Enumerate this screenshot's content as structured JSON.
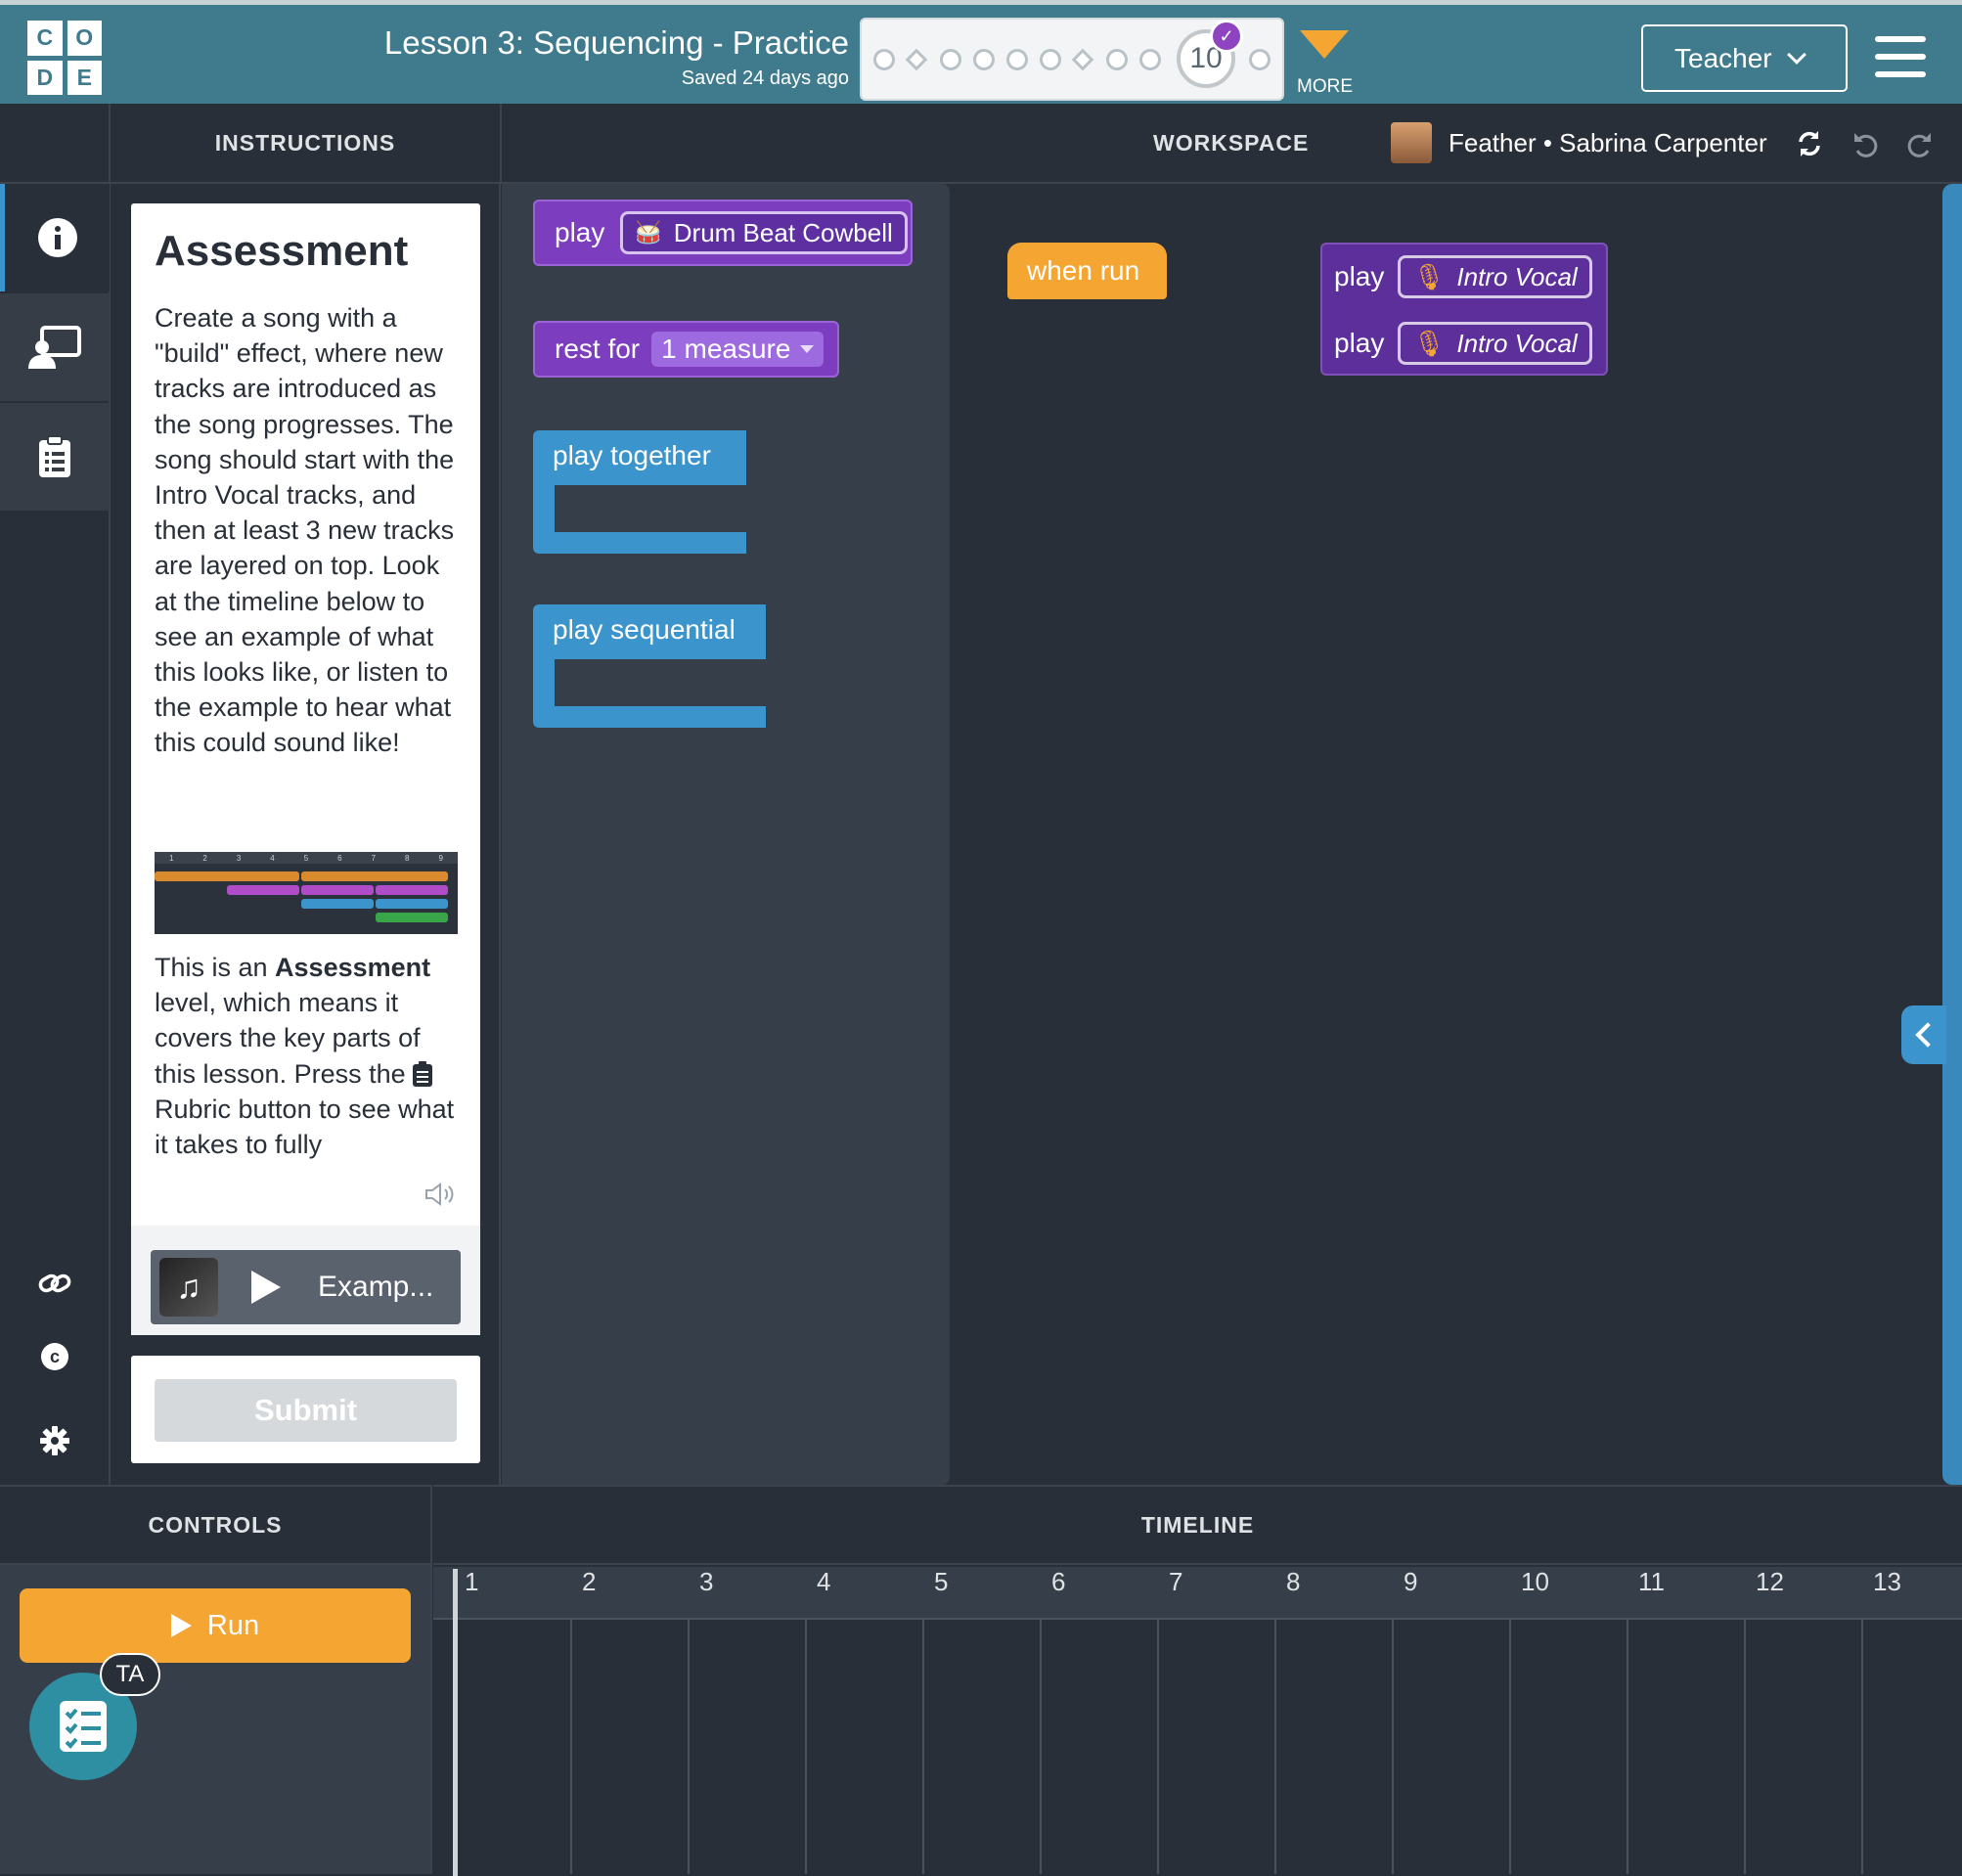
{
  "header": {
    "logo_letters": [
      "C",
      "O",
      "D",
      "E"
    ],
    "lesson_title": "Lesson 3: Sequencing - Practice",
    "saved_status": "Saved 24 days ago",
    "current_level": "10",
    "more_label": "MORE",
    "teacher_label": "Teacher"
  },
  "panels": {
    "instructions": "INSTRUCTIONS",
    "workspace": "WORKSPACE",
    "controls": "CONTROLS",
    "timeline": "TIMELINE"
  },
  "workspace_header": {
    "pack_label": "Feather • Sabrina Carpenter"
  },
  "instructions": {
    "title": "Assessment",
    "body": "Create a song with a \"build\" effect, where new tracks are introduced as the song progresses. The song should start with the Intro Vocal tracks, and then at least 3 new tracks are layered on top. Look at the timeline below to see an example of what this looks like, or listen to the example to hear what this could sound like!",
    "assess_prefix": "This is an ",
    "assess_bold": "Assessment",
    "assess_rest": " level, which means it covers the key parts of this lesson. Press the",
    "assess_rest2": "Rubric button to see what it takes to fully",
    "example_label": "Examp...",
    "submit_label": "Submit",
    "mini_timeline_ticks": [
      "1",
      "2",
      "3",
      "4",
      "5",
      "6",
      "7",
      "8",
      "9"
    ]
  },
  "toolbox": {
    "play_label": "play",
    "drum_sound": "Drum Beat Cowbell",
    "rest_label": "rest for",
    "rest_value": "1 measure",
    "play_together": "play together",
    "play_sequential": "play sequential"
  },
  "workspace_blocks": {
    "when_run": "when run",
    "play1": "play",
    "sound1": "Intro Vocal",
    "play2": "play",
    "sound2": "Intro Vocal"
  },
  "controls": {
    "run_label": "Run",
    "ta_badge": "TA"
  },
  "timeline_measures": [
    "1",
    "2",
    "3",
    "4",
    "5",
    "6",
    "7",
    "8",
    "9",
    "10",
    "11",
    "12",
    "13"
  ],
  "colors": {
    "header_bg": "#3f7b8d",
    "event_block": "#f5a532",
    "sound_block": "#7c3ebe",
    "flow_block": "#3b94cb",
    "run_button": "#f5a532"
  }
}
